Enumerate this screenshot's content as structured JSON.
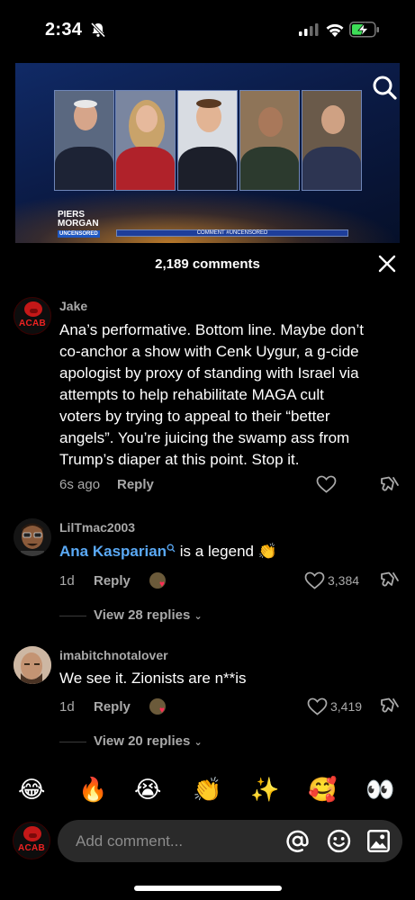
{
  "status_bar": {
    "time": "2:34"
  },
  "video": {
    "show_name_line1": "PIERS",
    "show_name_line2": "MORGAN",
    "show_name_sub": "UNCENSORED",
    "ticker": "COMMENT #UNCENSORED"
  },
  "comments_header": {
    "title": "2,189 comments"
  },
  "comments": [
    {
      "username": "Jake",
      "avatar_text": "ACAB",
      "lines": [
        "Ana’s performative. Bottom line. Maybe don’t",
        "co-anchor a show with Cenk Uygur, a g-cide",
        "apologist by proxy of standing with Israel via",
        "attempts to help rehabilitate MAGA cult",
        "voters by trying to appeal to their “better",
        "angels”. You’re juicing the swamp ass from",
        "Trump’s diaper at this point. Stop it."
      ],
      "time": "6s ago",
      "reply": "Reply"
    },
    {
      "username": "LilTmac2003",
      "mention": "Ana Kasparian",
      "text": " is a legend 👏",
      "time": "1d",
      "reply": "Reply",
      "likes": "3,384",
      "view_replies": "View 28 replies"
    },
    {
      "username": "imabitchnotalover",
      "text": "We see it. Zionists are n**is",
      "time": "1d",
      "reply": "Reply",
      "likes": "3,419",
      "view_replies": "View 20 replies"
    }
  ],
  "emoji_bar": [
    "😂",
    "🔥",
    "😭",
    "👏",
    "✨",
    "🥰",
    "👀"
  ],
  "input": {
    "placeholder": "Add comment...",
    "avatar_text": "ACAB"
  }
}
